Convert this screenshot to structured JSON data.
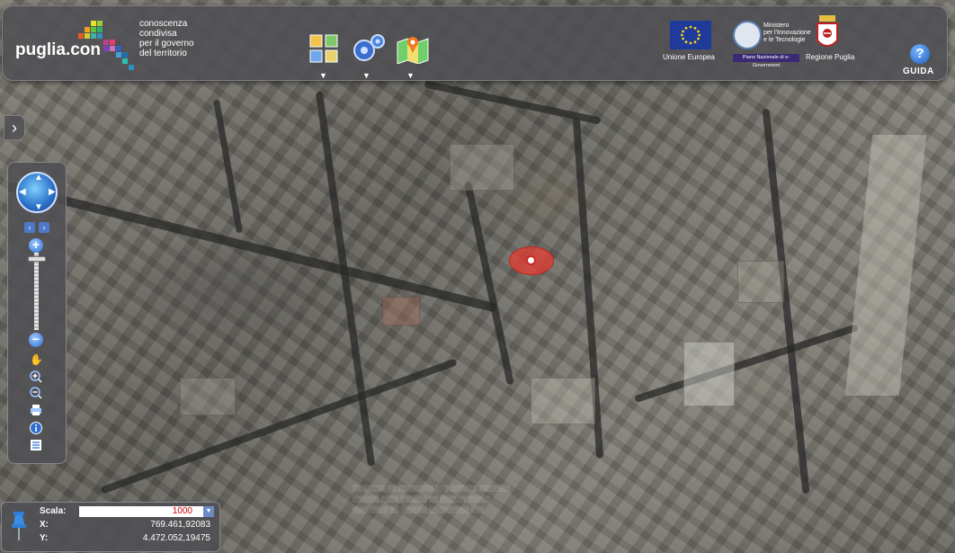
{
  "header": {
    "logo": "puglia.con",
    "tagline_lines": [
      "conoscenza",
      "condivisa",
      "per il governo",
      "del territorio"
    ],
    "tools": [
      {
        "name": "layers",
        "icon": "layers-grid-icon"
      },
      {
        "name": "settings",
        "icon": "gears-icon"
      },
      {
        "name": "map",
        "icon": "map-pin-icon"
      }
    ],
    "dropdown_arrow": "▼",
    "eu_label": "Unione Europea",
    "ministry_lines": [
      "Ministero",
      "per l'Innovazione",
      "e le Tecnologie"
    ],
    "pn_label": "Piano Nazionale di e-Government",
    "region_label": "Regione Puglia",
    "help_icon": "?",
    "help_label": "GUIDA"
  },
  "side_toggle": "›",
  "nav": {
    "pan_left": "‹",
    "pan_right": "›",
    "zoom_in": "+",
    "zoom_out": "−",
    "zoom_level": 0.05,
    "tools": [
      "hand-icon",
      "zoom-in-box-icon",
      "zoom-out-box-icon",
      "print-icon",
      "info-icon",
      "legend-icon"
    ]
  },
  "coords": {
    "scale_label": "Scala:",
    "scale_value": "1000",
    "x_label": "X:",
    "x_value": "769.461,92083",
    "y_label": "Y:",
    "y_value": "4.472.052,19475"
  },
  "colors": {
    "panel": "#505054",
    "marker": "#e63c32",
    "accent_blue": "#2f6fd1"
  }
}
